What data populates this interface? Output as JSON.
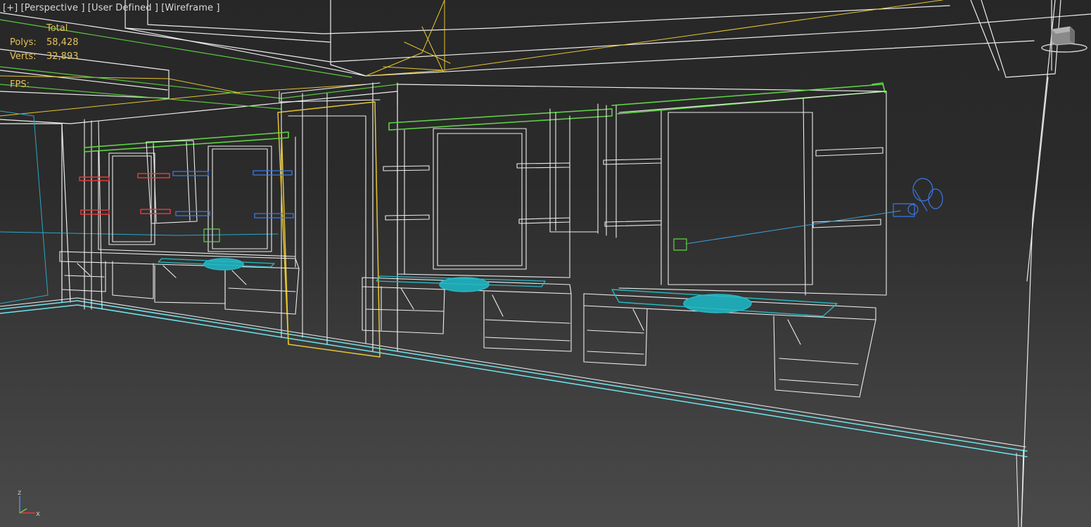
{
  "viewport": {
    "label_plus": "[+]",
    "label_view": "[Perspective ]",
    "label_camera": "[User Defined ]",
    "label_mode": "[Wireframe ]"
  },
  "stats": {
    "header": "Total",
    "polys_label": "Polys:",
    "polys_value": "58,428",
    "verts_label": "Verts:",
    "verts_value": "32,893",
    "fps_label": "FPS:"
  },
  "axis": {
    "z": "z",
    "x": "x"
  },
  "colors": {
    "background": "#2b2b2b",
    "wire_white": "#f2f2f2",
    "wire_yellow": "#e6c531",
    "wire_green": "#5fd445",
    "wire_cyan": "#29b8c2",
    "wire_blue": "#3a78e8",
    "wire_red": "#e23a3a",
    "stats_text": "#e4c25a"
  },
  "icons": {
    "viewcube": "viewcube-icon",
    "axis": "axis-tripod-icon",
    "camera": "camera-icon"
  }
}
